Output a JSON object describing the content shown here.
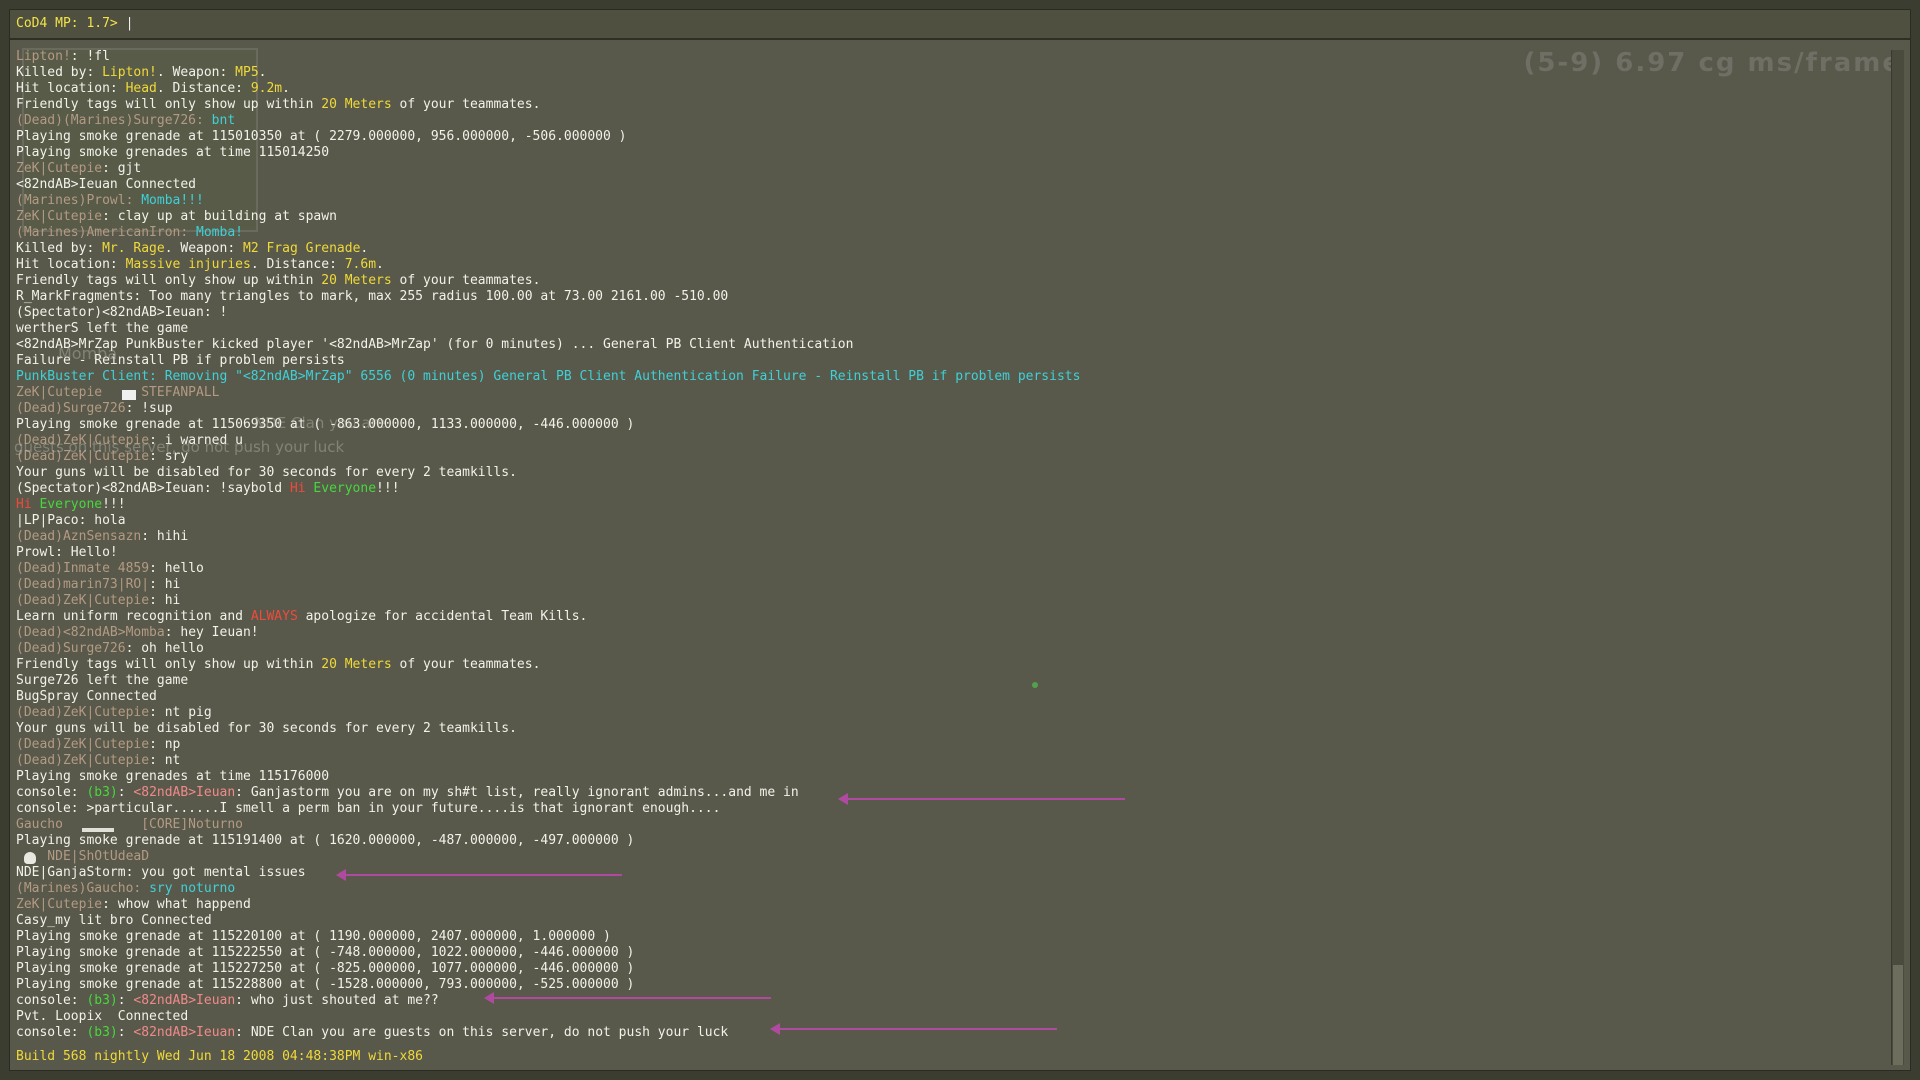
{
  "console": {
    "prompt": "CoD4 MP: 1.7>",
    "input_value": "",
    "perf_overlay": "(5-9) 6.97 cg ms/frame",
    "build": "Build 568 nightly Wed Jun 18 2008 04:48:38PM win-x86",
    "ghost_killfeed": "NDE Clan you are",
    "ghost_killfeed_2": "guests on this server, do not push your luck",
    "ghost_name": "Momba"
  },
  "colors": {
    "prompt": "#f2e34a",
    "highlight": "#f0d93a",
    "team_name": "#b39a84",
    "admin_name": "#f08a8a",
    "chat_cyan": "#3fd0d8",
    "annotation_arrow": "#b04aa0"
  },
  "log": [
    [
      [
        "Lipton!",
        "t"
      ],
      [
        ": !fl",
        "w"
      ]
    ],
    [
      [
        "Killed by: ",
        "w"
      ],
      [
        "Lipton!",
        "y"
      ],
      [
        ". Weapon: ",
        "w"
      ],
      [
        "MP5",
        "y"
      ],
      [
        ".",
        "w"
      ]
    ],
    [
      [
        "Hit location: ",
        "w"
      ],
      [
        "Head",
        "y"
      ],
      [
        ". Distance: ",
        "w"
      ],
      [
        "9.2m",
        "y"
      ],
      [
        ".",
        "w"
      ]
    ],
    [
      [
        "Friendly tags will only show up within ",
        "w"
      ],
      [
        "20 Meters",
        "y"
      ],
      [
        " of your teammates.",
        "w"
      ]
    ],
    [
      [
        "(Dead)(Marines)Surge726: ",
        "t"
      ],
      [
        "bnt",
        "c"
      ]
    ],
    [
      [
        "Playing smoke grenade at 115010350 at ( 2279.000000, 956.000000, -506.000000 )",
        "w"
      ]
    ],
    [
      [
        "Playing smoke grenades at time 115014250",
        "w"
      ]
    ],
    [
      [
        "ZeK|Cutepie",
        "t"
      ],
      [
        ": gjt",
        "w"
      ]
    ],
    [
      [
        "<82ndAB>Ieuan Connected",
        "w"
      ]
    ],
    [
      [
        "(Marines)Prowl: ",
        "t"
      ],
      [
        "Momba!!!",
        "c"
      ]
    ],
    [
      [
        "ZeK|Cutepie",
        "t"
      ],
      [
        ": clay up at building at spawn",
        "w"
      ]
    ],
    [
      [
        "(Marines)AmericanIron: ",
        "t"
      ],
      [
        "Momba!",
        "c"
      ]
    ],
    [
      [
        "Killed by: ",
        "w"
      ],
      [
        "Mr. Rage",
        "y"
      ],
      [
        ". Weapon: ",
        "w"
      ],
      [
        "M2 Frag Grenade",
        "y"
      ],
      [
        ".",
        "w"
      ]
    ],
    [
      [
        "Hit location: ",
        "w"
      ],
      [
        "Massive injuries",
        "y"
      ],
      [
        ". Distance: ",
        "w"
      ],
      [
        "7.6m",
        "y"
      ],
      [
        ".",
        "w"
      ]
    ],
    [
      [
        "Friendly tags will only show up within ",
        "w"
      ],
      [
        "20 Meters",
        "y"
      ],
      [
        " of your teammates.",
        "w"
      ]
    ],
    [
      [
        "R_MarkFragments: Too many triangles to mark, max 255 radius 100.00 at 73.00 2161.00 -510.00",
        "w"
      ]
    ],
    [
      [
        "(Spectator)<82ndAB>Ieuan: !",
        "w"
      ]
    ],
    [
      [
        "wertherS left the game",
        "w"
      ]
    ],
    [
      [
        "<82ndAB>MrZap PunkBuster kicked player '<82ndAB>MrZap' (for 0 minutes) ... General PB Client Authentication",
        "w"
      ]
    ],
    [
      [
        "Failure - Reinstall PB if problem persists",
        "w"
      ]
    ],
    [
      [
        "PunkBuster Client: Removing \"<82ndAB>MrZap\" 6556 (0 minutes) General PB Client Authentication Failure - Reinstall PB if problem persists",
        "c"
      ]
    ],
    [
      [
        "ZeK|Cutepie",
        "t"
      ],
      [
        "     STEFANPALL",
        "t"
      ]
    ],
    [
      [
        "(Dead)Surge726",
        "t"
      ],
      [
        ": !sup",
        "w"
      ]
    ],
    [
      [
        "Playing smoke grenade at 115069350 at ( -863.000000, 1133.000000, -446.000000 )",
        "w"
      ]
    ],
    [
      [
        "(Dead)ZeK|Cutepie",
        "t"
      ],
      [
        ": i warned u",
        "w"
      ]
    ],
    [
      [
        "(Dead)ZeK|Cutepie",
        "t"
      ],
      [
        ": sry",
        "w"
      ]
    ],
    [
      [
        "Your guns will be disabled for 30 seconds for every 2 teamkills.",
        "w"
      ]
    ],
    [
      [
        "(Spectator)<82ndAB>Ieuan: !saybold ",
        "w"
      ],
      [
        "Hi ",
        "r"
      ],
      [
        "Everyone",
        "g"
      ],
      [
        "!!!",
        "w"
      ]
    ],
    [
      [
        "Hi ",
        "r"
      ],
      [
        "Everyone",
        "g"
      ],
      [
        "!!!",
        "w"
      ]
    ],
    [
      [
        "|LP|Paco: hola",
        "w"
      ]
    ],
    [
      [
        "(Dead)AznSensazn",
        "t"
      ],
      [
        ": hihi",
        "w"
      ]
    ],
    [
      [
        "Prowl: Hello!",
        "w"
      ]
    ],
    [
      [
        "(Dead)Inmate 4859",
        "t"
      ],
      [
        ": hello",
        "w"
      ]
    ],
    [
      [
        "(Dead)marin73|RO|",
        "t"
      ],
      [
        ": hi",
        "w"
      ]
    ],
    [
      [
        "(Dead)ZeK|Cutepie",
        "t"
      ],
      [
        ": hi",
        "w"
      ]
    ],
    [
      [
        "Learn uniform recognition and ",
        "w"
      ],
      [
        "ALWAYS",
        "r"
      ],
      [
        " apologize for accidental Team Kills.",
        "w"
      ]
    ],
    [
      [
        "(Dead)<82ndAB>Momba",
        "t"
      ],
      [
        ": hey Ieuan!",
        "w"
      ]
    ],
    [
      [
        "(Dead)Surge726",
        "t"
      ],
      [
        ": oh hello",
        "w"
      ]
    ],
    [
      [
        "Friendly tags will only show up within ",
        "w"
      ],
      [
        "20 Meters",
        "y"
      ],
      [
        " of your teammates.",
        "w"
      ]
    ],
    [
      [
        "Surge726 left the game",
        "w"
      ]
    ],
    [
      [
        "BugSpray Connected",
        "w"
      ]
    ],
    [
      [
        "(Dead)ZeK|Cutepie",
        "t"
      ],
      [
        ": nt pig",
        "w"
      ]
    ],
    [
      [
        "Your guns will be disabled for 30 seconds for every 2 teamkills.",
        "w"
      ]
    ],
    [
      [
        "(Dead)ZeK|Cutepie",
        "t"
      ],
      [
        ": np",
        "w"
      ]
    ],
    [
      [
        "(Dead)ZeK|Cutepie",
        "t"
      ],
      [
        ": nt",
        "w"
      ]
    ],
    [
      [
        "Playing smoke grenades at time 115176000",
        "w"
      ]
    ],
    [
      [
        "console: ",
        "w"
      ],
      [
        "(b3)",
        "g"
      ],
      [
        ": ",
        "w"
      ],
      [
        "<82ndAB>Ieuan",
        "m"
      ],
      [
        ": Ganjastorm you are on my sh#t list, really ignorant admins...and me in",
        "w"
      ]
    ],
    [
      [
        "console: >particular......I smell a perm ban in your future....is that ignorant enough....",
        "w"
      ]
    ],
    [
      [
        "Gaucho          [CORE]Noturno",
        "t"
      ]
    ],
    [
      [
        "Playing smoke grenade at 115191400 at ( 1620.000000, -487.000000, -497.000000 )",
        "w"
      ]
    ],
    [
      [
        "    NDE|ShOtUdeaD",
        "t"
      ]
    ],
    [
      [
        "NDE|GanjaStorm: you got mental issues",
        "w"
      ]
    ],
    [
      [
        "(Marines)Gaucho: ",
        "t"
      ],
      [
        "sry noturno",
        "c"
      ]
    ],
    [
      [
        "ZeK|Cutepie",
        "t"
      ],
      [
        ": whow what happend",
        "w"
      ]
    ],
    [
      [
        "Casy_my lit bro Connected",
        "w"
      ]
    ],
    [
      [
        "Playing smoke grenade at 115220100 at ( 1190.000000, 2407.000000, 1.000000 )",
        "w"
      ]
    ],
    [
      [
        "Playing smoke grenade at 115222550 at ( -748.000000, 1022.000000, -446.000000 )",
        "w"
      ]
    ],
    [
      [
        "Playing smoke grenade at 115227250 at ( -825.000000, 1077.000000, -446.000000 )",
        "w"
      ]
    ],
    [
      [
        "Playing smoke grenade at 115228800 at ( -1528.000000, 793.000000, -525.000000 )",
        "w"
      ]
    ],
    [
      [
        "console: ",
        "w"
      ],
      [
        "(b3)",
        "g"
      ],
      [
        ": ",
        "w"
      ],
      [
        "<82ndAB>Ieuan",
        "m"
      ],
      [
        ": who just shouted at me??",
        "w"
      ]
    ],
    [
      [
        "Pvt. Loopix  Connected",
        "w"
      ]
    ],
    [
      [
        "console: ",
        "w"
      ],
      [
        "(b3)",
        "g"
      ],
      [
        ": ",
        "w"
      ],
      [
        "<82ndAB>Ieuan",
        "m"
      ],
      [
        ": NDE Clan you are guests on this server, do not push your luck",
        "w"
      ]
    ]
  ]
}
